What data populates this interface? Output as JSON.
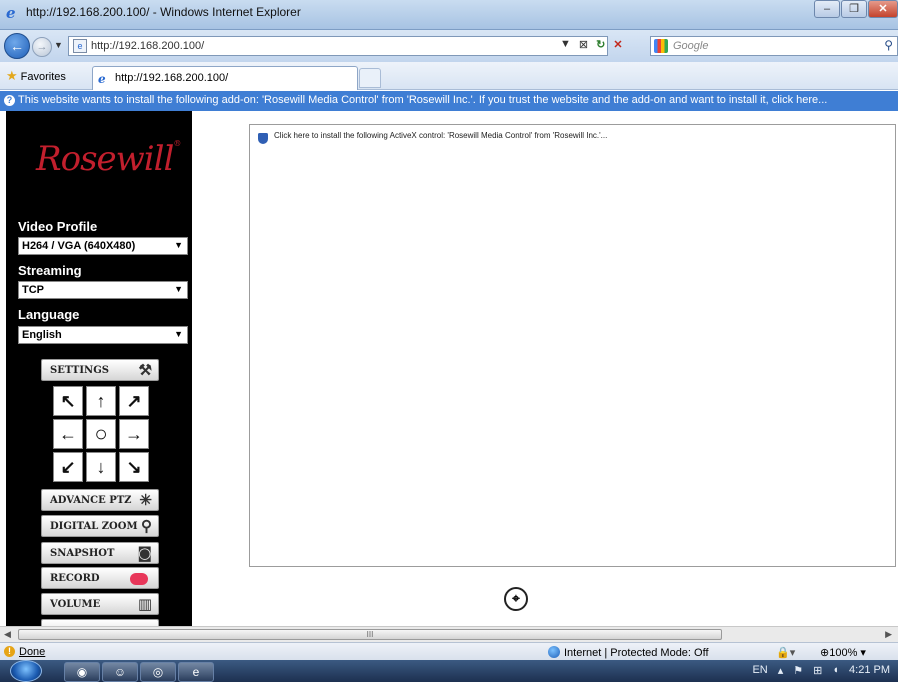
{
  "window": {
    "title": "http://192.168.200.100/ - Windows Internet Explorer",
    "minimize": "–",
    "maximize": "❐",
    "close": "✕"
  },
  "nav": {
    "url": "http://192.168.200.100/",
    "search_placeholder": "Google",
    "back_icon": "arrow-left",
    "forward_icon": "arrow-right"
  },
  "favorites": {
    "label": "Favorites",
    "tab_title": "http://192.168.200.100/"
  },
  "infobar": {
    "message": "This website wants to install the following add-on: 'Rosewill Media Control' from 'Rosewill Inc.'. If you trust the website and the add-on and want to install it, click here..."
  },
  "sidebar": {
    "logo": "Rosewill",
    "video_profile_label": "Video Profile",
    "video_profile_value": "H264 / VGA (640X480)",
    "streaming_label": "Streaming",
    "streaming_value": "TCP",
    "language_label": "Language",
    "language_value": "English",
    "buttons": {
      "settings": "SETTINGS",
      "advance_ptz": "ADVANCE PTZ",
      "digital_zoom": "DIGITAL ZOOM",
      "snapshot": "SNAPSHOT",
      "record": "RECORD",
      "volume": "VOLUME"
    }
  },
  "viewer": {
    "activex_message": "Click here to install the following ActiveX control: 'Rosewill Media Control' from 'Rosewill Inc.'..."
  },
  "scrollbar": {
    "grip": "III"
  },
  "status": {
    "text": "Done",
    "zone": "Internet | Protected Mode: Off",
    "zoom": "100%"
  },
  "taskbar": {
    "lang": "EN",
    "time": "4:21 PM"
  },
  "colors": {
    "brand_red": "#c21f2d",
    "infobar_blue": "#3f7ed4",
    "record_red": "#e8375a"
  }
}
